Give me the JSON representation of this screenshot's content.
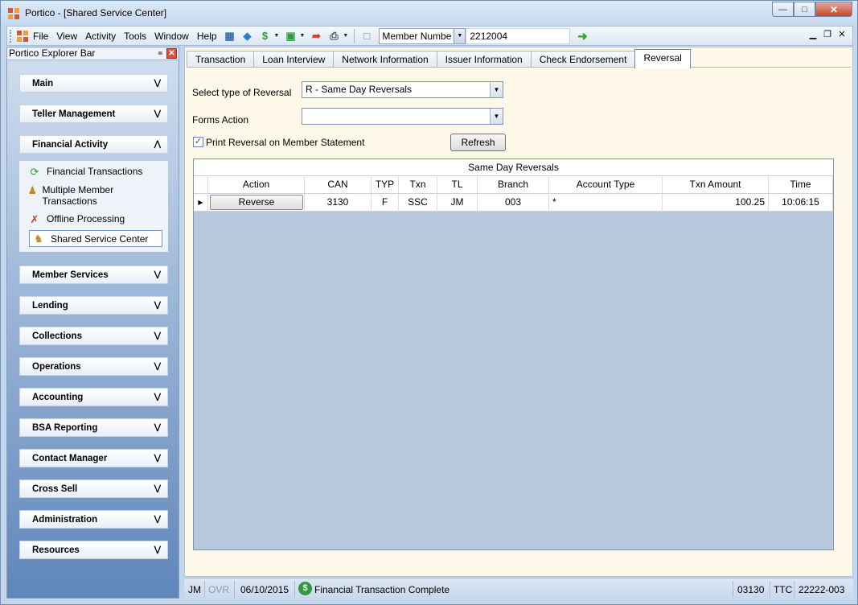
{
  "window": {
    "title": "Portico - [Shared Service Center]"
  },
  "menu": {
    "items": [
      "File",
      "View",
      "Activity",
      "Tools",
      "Window",
      "Help"
    ],
    "member_search": {
      "field_label": "Member Numbe",
      "value": "2212004"
    }
  },
  "explorer": {
    "title": "Portico Explorer Bar",
    "groups": [
      {
        "label": "Main",
        "expanded": false
      },
      {
        "label": "Teller Management",
        "expanded": false
      },
      {
        "label": "Financial Activity",
        "expanded": true
      },
      {
        "label": "Member Services",
        "expanded": false
      },
      {
        "label": "Lending",
        "expanded": false
      },
      {
        "label": "Collections",
        "expanded": false
      },
      {
        "label": "Operations",
        "expanded": false
      },
      {
        "label": "Accounting",
        "expanded": false
      },
      {
        "label": "BSA Reporting",
        "expanded": false
      },
      {
        "label": "Contact Manager",
        "expanded": false
      },
      {
        "label": "Cross Sell",
        "expanded": false
      },
      {
        "label": "Administration",
        "expanded": false
      },
      {
        "label": "Resources",
        "expanded": false
      }
    ],
    "financial_activity_tasks": [
      {
        "label": "Financial Transactions",
        "icon": "money-transfer-icon"
      },
      {
        "label": "Multiple Member Transactions",
        "icon": "multiple-members-icon"
      },
      {
        "label": "Offline Processing",
        "icon": "offline-icon"
      },
      {
        "label": "Shared Service Center",
        "icon": "shared-service-icon",
        "selected": true
      }
    ]
  },
  "tabs": [
    {
      "label": "Transaction"
    },
    {
      "label": "Loan Interview"
    },
    {
      "label": "Network Information"
    },
    {
      "label": "Issuer Information"
    },
    {
      "label": "Check Endorsement"
    },
    {
      "label": "Reversal",
      "active": true
    }
  ],
  "reversal": {
    "type_label": "Select type of Reversal",
    "type_value": "R - Same Day Reversals",
    "forms_label": "Forms Action",
    "forms_value": "",
    "print_label": "Print Reversal on Member Statement",
    "print_checked": true,
    "refresh_label": "Refresh"
  },
  "grid": {
    "caption": "Same Day Reversals",
    "columns": [
      "Action",
      "CAN",
      "TYP",
      "Txn",
      "TL",
      "Branch",
      "Account Type",
      "Txn Amount",
      "Time"
    ],
    "rows": [
      {
        "action": "Reverse",
        "can": "3130",
        "typ": "F",
        "txn": "SSC",
        "tl": "JM",
        "branch": "003",
        "account_type": "*",
        "txn_amount": "100.25",
        "time": "10:06:15"
      }
    ]
  },
  "status": {
    "user": "JM",
    "ovr": "OVR",
    "date": "06/10/2015",
    "message": "Financial Transaction Complete",
    "branch_code": "03130",
    "mode": "TTC",
    "terminal": "22222-003"
  },
  "colors": {
    "accent": "#2f9a3b",
    "explorer_gradient_bottom": "#5f86ba"
  }
}
